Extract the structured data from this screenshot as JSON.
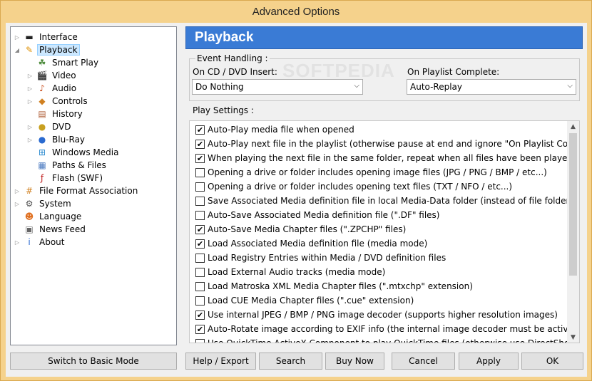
{
  "window": {
    "title": "Advanced Options"
  },
  "tree": [
    {
      "label": "Interface",
      "icon": "interface-icon",
      "expand": true
    },
    {
      "label": "Playback",
      "icon": "playback-icon",
      "expand": true,
      "selected": true
    },
    {
      "label": "Smart Play",
      "icon": "smart-play-icon",
      "expand": false
    },
    {
      "label": "Video",
      "icon": "video-icon",
      "expand": true
    },
    {
      "label": "Audio",
      "icon": "audio-icon",
      "expand": true
    },
    {
      "label": "Controls",
      "icon": "controls-icon",
      "expand": true
    },
    {
      "label": "History",
      "icon": "history-icon",
      "expand": false
    },
    {
      "label": "DVD",
      "icon": "dvd-icon",
      "expand": true
    },
    {
      "label": "Blu-Ray",
      "icon": "bluray-icon",
      "expand": true
    },
    {
      "label": "Windows Media",
      "icon": "windows-media-icon",
      "expand": false
    },
    {
      "label": "Paths & Files",
      "icon": "paths-files-icon",
      "expand": false
    },
    {
      "label": "Flash (SWF)",
      "icon": "flash-icon",
      "expand": false
    },
    {
      "label": "File Format Association",
      "icon": "file-format-icon",
      "expand": true
    },
    {
      "label": "System",
      "icon": "system-icon",
      "expand": true
    },
    {
      "label": "Language",
      "icon": "language-icon",
      "expand": false
    },
    {
      "label": "News Feed",
      "icon": "news-feed-icon",
      "expand": false
    },
    {
      "label": "About",
      "icon": "about-icon",
      "expand": true
    }
  ],
  "header": {
    "title": "Playback"
  },
  "event_handling": {
    "title": "Event Handling :",
    "cd_label": "On CD / DVD Insert:",
    "cd_value": "Do Nothing",
    "playlist_label": "On Playlist Complete:",
    "playlist_value": "Auto-Replay"
  },
  "watermark": "SOFTPEDIA",
  "play_settings": {
    "title": "Play Settings :",
    "items": [
      {
        "label": "Auto-Play media file when opened",
        "checked": true
      },
      {
        "label": "Auto-Play next file in the playlist (otherwise pause at end and ignore \"On Playlist Complete\")",
        "checked": true
      },
      {
        "label": "When playing the next file in the same folder, repeat when all files have been played",
        "checked": true
      },
      {
        "label": "Opening a drive or folder includes opening image files (JPG / PNG / BMP / etc...)",
        "checked": false
      },
      {
        "label": "Opening a drive or folder includes opening text files (TXT / NFO / etc...)",
        "checked": false
      },
      {
        "label": "Save Associated Media definition file in local Media-Data folder (instead of file folder)",
        "checked": false
      },
      {
        "label": "Auto-Save Associated Media definition file (\".DF\" files)",
        "checked": false
      },
      {
        "label": "Auto-Save Media Chapter files (\".ZPCHP\" files)",
        "checked": true
      },
      {
        "label": "Load Associated Media definition file (media mode)",
        "checked": true
      },
      {
        "label": "Load Registry Entries within Media / DVD definition files",
        "checked": false
      },
      {
        "label": "Load External Audio tracks (media mode)",
        "checked": false
      },
      {
        "label": "Load Matroska XML Media Chapter files (\".mtxchp\" extension)",
        "checked": false
      },
      {
        "label": "Load CUE Media Chapter files (\".cue\" extension)",
        "checked": false
      },
      {
        "label": "Use internal JPEG / BMP / PNG image decoder (supports higher resolution images)",
        "checked": true
      },
      {
        "label": "Auto-Rotate image according to EXIF info (the internal image decoder must be active)",
        "checked": true
      },
      {
        "label": "Use QuickTime ActiveX Component to play QuickTime files (otherwise use DirectShow)",
        "checked": false
      }
    ]
  },
  "buttons": {
    "basic_mode": "Switch to Basic Mode",
    "help": "Help / Export",
    "search": "Search",
    "buy": "Buy Now",
    "cancel": "Cancel",
    "apply": "Apply",
    "ok": "OK"
  }
}
